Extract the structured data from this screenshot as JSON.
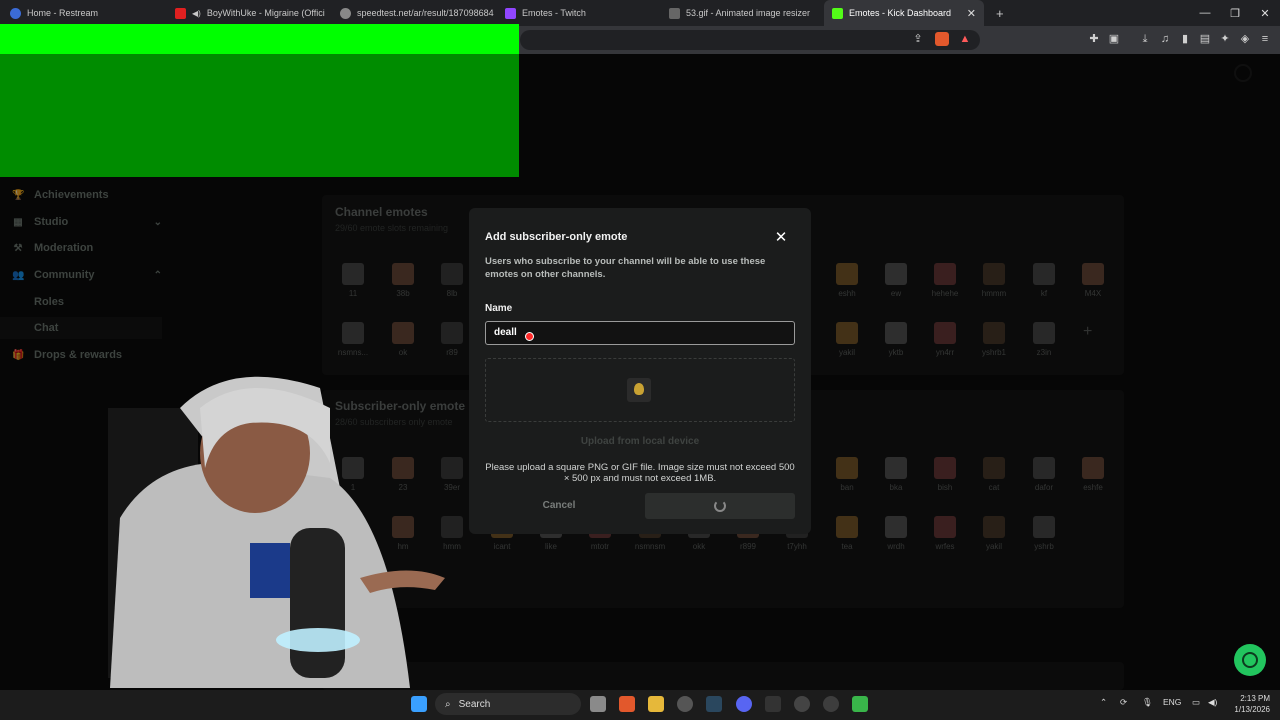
{
  "browser": {
    "tabs": [
      {
        "label": "Home - Restream",
        "color": "#3b6bd6",
        "active": false
      },
      {
        "label": "BoyWithUke - Migraine (Official",
        "color": "#e02020",
        "active": false
      },
      {
        "label": "speedtest.net/ar/result/18709868402",
        "color": "#888888",
        "active": false
      },
      {
        "label": "Emotes - Twitch",
        "color": "#9146ff",
        "active": false
      },
      {
        "label": "53.gif - Animated image resizer",
        "color": "#666666",
        "active": false
      },
      {
        "label": "Emotes - Kick Dashboard",
        "color": "#53fc18",
        "active": true
      }
    ],
    "new_tab": "+",
    "close_tab": "✕"
  },
  "sidebar": {
    "items": [
      {
        "label": "Achievements",
        "icon": "trophy-icon"
      },
      {
        "label": "Studio",
        "icon": "studio-icon"
      },
      {
        "label": "Moderation",
        "icon": "hammer-icon"
      },
      {
        "label": "Community",
        "icon": "people-icon"
      },
      {
        "label": "Roles"
      },
      {
        "label": "Chat"
      },
      {
        "label": "Drops & rewards",
        "icon": "gift-icon"
      }
    ]
  },
  "channel_emotes": {
    "title": "Channel emotes",
    "subtitle": "29/60 emote slots remaining",
    "row1": [
      "11",
      "38b",
      "8lb",
      "eshh",
      "ew",
      "hehehe",
      "hmmm",
      "kf",
      "M4X"
    ],
    "row2": [
      "nsmns...",
      "ok",
      "r89",
      "yakil",
      "yktb",
      "yn4rr",
      "yshrb1",
      "z3in"
    ],
    "add": "+",
    "m4x_tile": "1M4X"
  },
  "subscriber_emotes": {
    "title": "Subscriber-only emote",
    "subtitle": "28/60 subscribers only emote",
    "row1": [
      "1",
      "23",
      "39er",
      "ban",
      "bka",
      "bish",
      "cat",
      "dafor",
      "eshfe"
    ],
    "row2": [
      "he",
      "hm",
      "hmm",
      "icant",
      "like",
      "mtotr",
      "nsmnsm",
      "okk",
      "r899",
      "t7yhh",
      "tea",
      "wrdh",
      "wrfes",
      "yakil",
      "yshrb"
    ]
  },
  "modal": {
    "title": "Add subscriber-only emote",
    "description": "Users who subscribe to your channel will be able to use these emotes on other channels.",
    "name_label": "Name",
    "name_value": "deall",
    "upload_label": "Upload from local device",
    "info": "Please upload a square PNG or GIF file. Image size must not exceed 500 × 500 px and must not exceed 1MB.",
    "cancel": "Cancel",
    "close": "✕"
  },
  "taskbar": {
    "search": "Search",
    "lang": "ENG",
    "time": "2:13 PM",
    "date": "1/13/2026"
  }
}
